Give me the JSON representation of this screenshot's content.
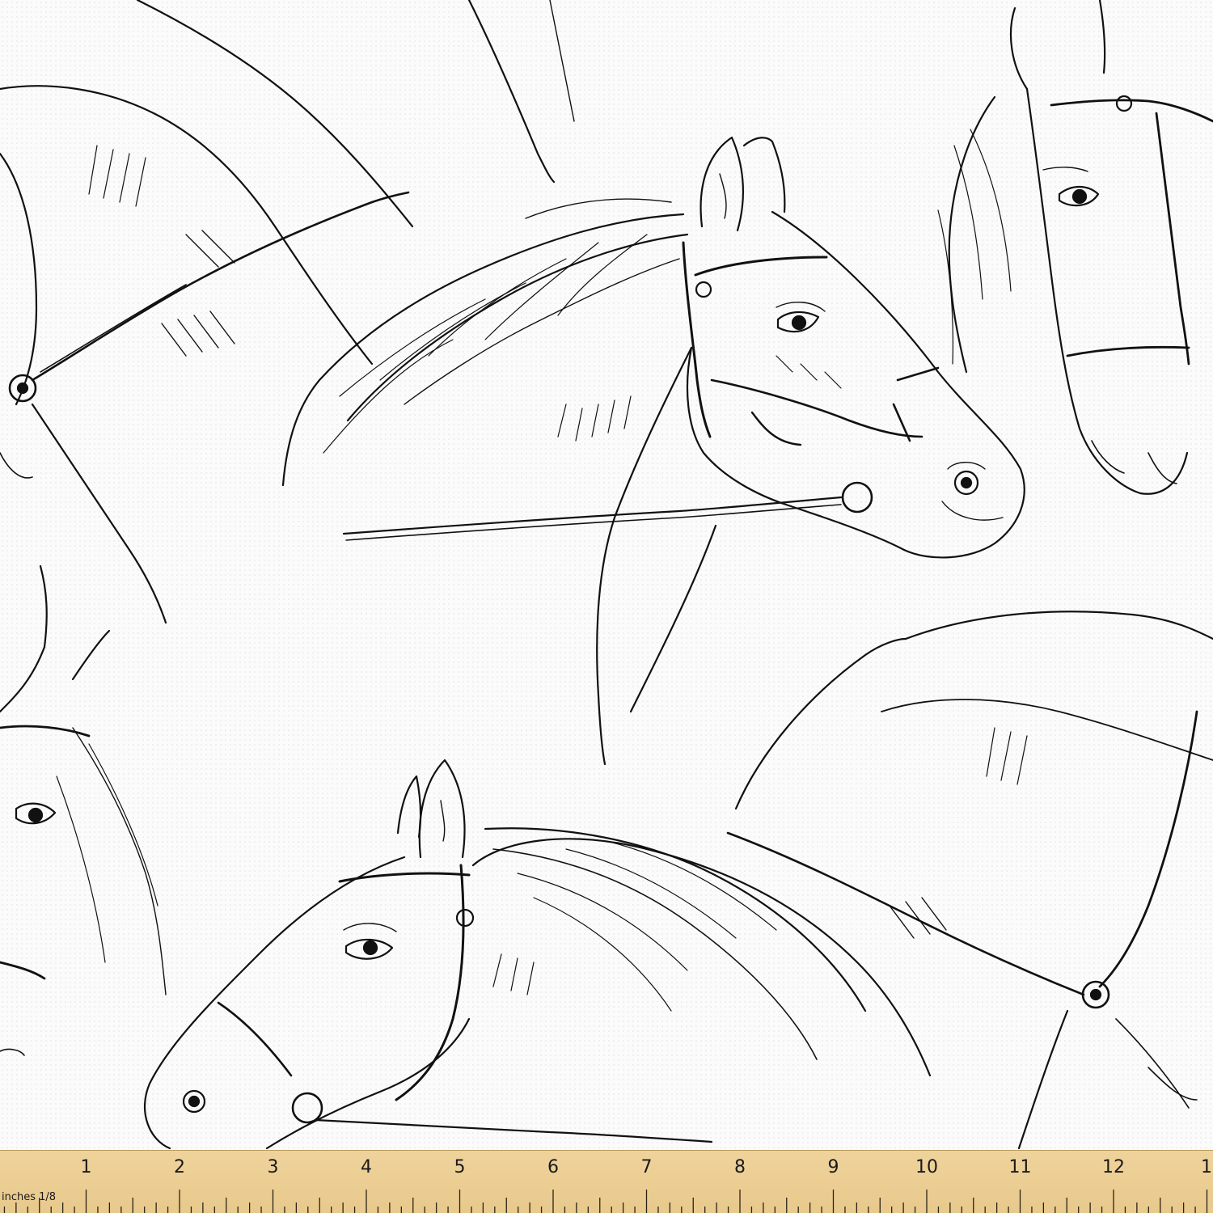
{
  "image": {
    "subject": "horse-heads-sketch-pattern",
    "line_color": "#111111",
    "fabric_color": "#fbfbfb"
  },
  "ruler": {
    "unit_label": "inches 1/8",
    "numbers": [
      "1",
      "2",
      "3",
      "4",
      "5",
      "6",
      "7",
      "8",
      "9",
      "10",
      "11",
      "12",
      "1"
    ],
    "color": "#ecce94"
  }
}
